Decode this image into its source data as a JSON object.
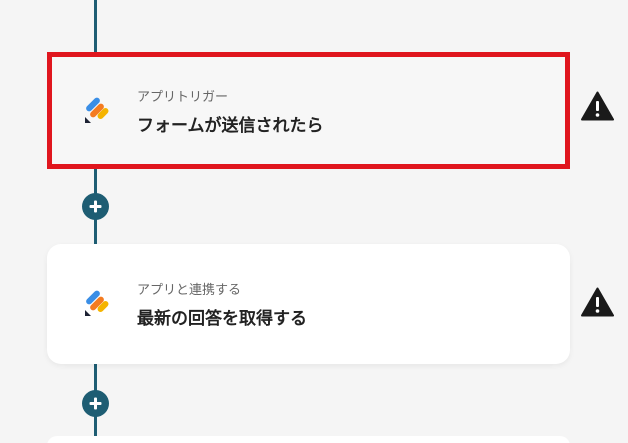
{
  "flow": {
    "steps": [
      {
        "subtitle": "アプリトリガー",
        "title": "フォームが送信されたら",
        "icon": "form-app-icon",
        "selected": true,
        "warning_icon": "warning-icon"
      },
      {
        "subtitle": "アプリと連携する",
        "title": "最新の回答を取得する",
        "icon": "form-app-icon",
        "selected": false,
        "warning_icon": "warning-icon"
      }
    ],
    "add_step_icon": "plus-icon"
  },
  "colors": {
    "connector": "#1e5d73",
    "selected_border": "#e0161e",
    "icon_blue": "#3a8ee6",
    "icon_orange": "#f47b20",
    "icon_yellow": "#f5b400",
    "icon_dark": "#1d2233"
  }
}
